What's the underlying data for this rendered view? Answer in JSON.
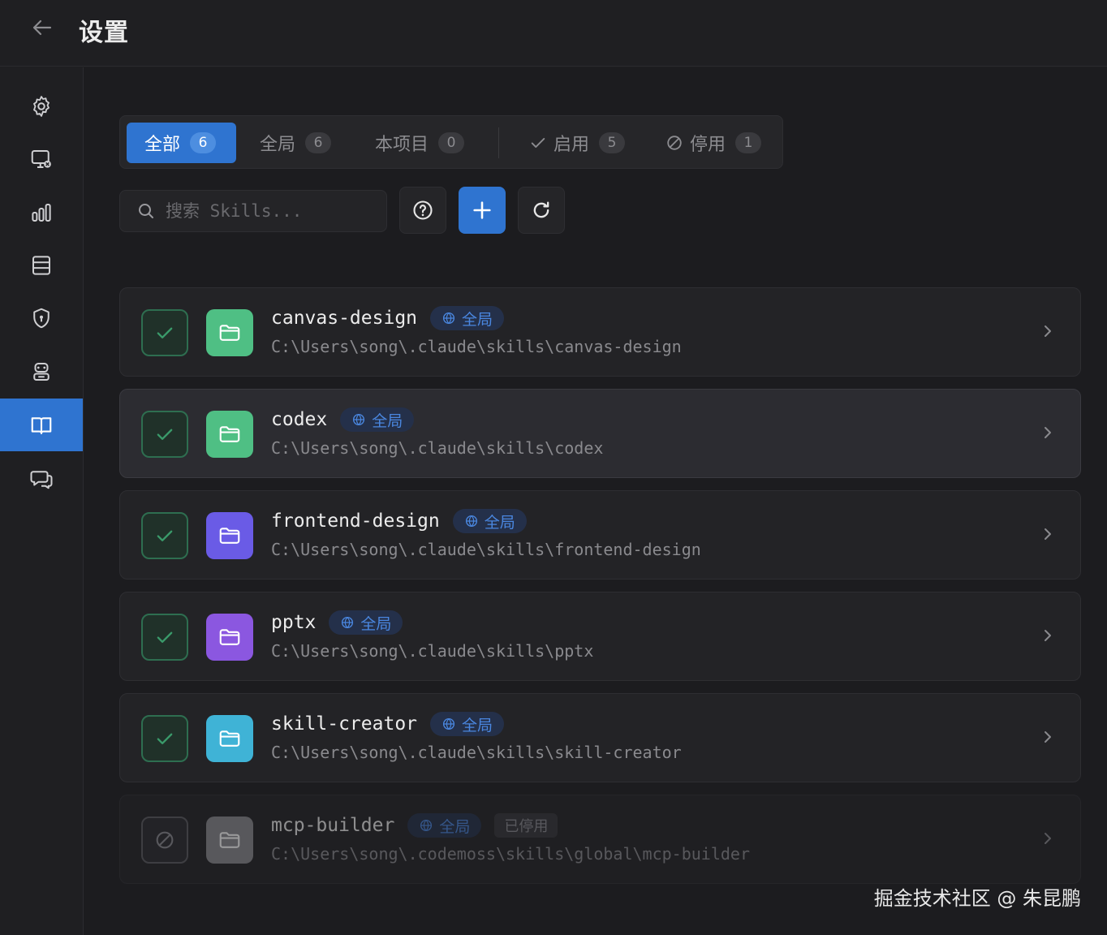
{
  "header": {
    "title": "设置"
  },
  "sidebar": {
    "items": [
      {
        "icon": "gear-icon"
      },
      {
        "icon": "monitor-settings-icon"
      },
      {
        "icon": "bar-chart-icon"
      },
      {
        "icon": "database-icon"
      },
      {
        "icon": "shield-icon"
      },
      {
        "icon": "robot-icon"
      },
      {
        "icon": "book-open-icon",
        "active": true
      },
      {
        "icon": "chat-icon"
      }
    ]
  },
  "tabs": [
    {
      "label": "全部",
      "count": "6",
      "active": true
    },
    {
      "label": "全局",
      "count": "6"
    },
    {
      "label": "本项目",
      "count": "0"
    },
    {
      "label": "启用",
      "count": "5",
      "icon": "check-icon"
    },
    {
      "label": "停用",
      "count": "1",
      "icon": "ban-icon"
    }
  ],
  "search": {
    "placeholder": "搜索 Skills..."
  },
  "skills": [
    {
      "name": "canvas-design",
      "scope": "全局",
      "path": "C:\\Users\\song\\.claude\\skills\\canvas-design",
      "enabled": true,
      "color": "#4fbf84"
    },
    {
      "name": "codex",
      "scope": "全局",
      "path": "C:\\Users\\song\\.claude\\skills\\codex",
      "enabled": true,
      "color": "#4fbf84"
    },
    {
      "name": "frontend-design",
      "scope": "全局",
      "path": "C:\\Users\\song\\.claude\\skills\\frontend-design",
      "enabled": true,
      "color": "#6a5be6"
    },
    {
      "name": "pptx",
      "scope": "全局",
      "path": "C:\\Users\\song\\.claude\\skills\\pptx",
      "enabled": true,
      "color": "#8b57e0"
    },
    {
      "name": "skill-creator",
      "scope": "全局",
      "path": "C:\\Users\\song\\.claude\\skills\\skill-creator",
      "enabled": true,
      "color": "#3fb3d6"
    },
    {
      "name": "mcp-builder",
      "scope": "全局",
      "status": "已停用",
      "path": "C:\\Users\\song\\.codemoss\\skills\\global\\mcp-builder",
      "enabled": false,
      "color": "#8a8a8e"
    }
  ],
  "watermark": "掘金技术社区 @ 朱昆鹏"
}
